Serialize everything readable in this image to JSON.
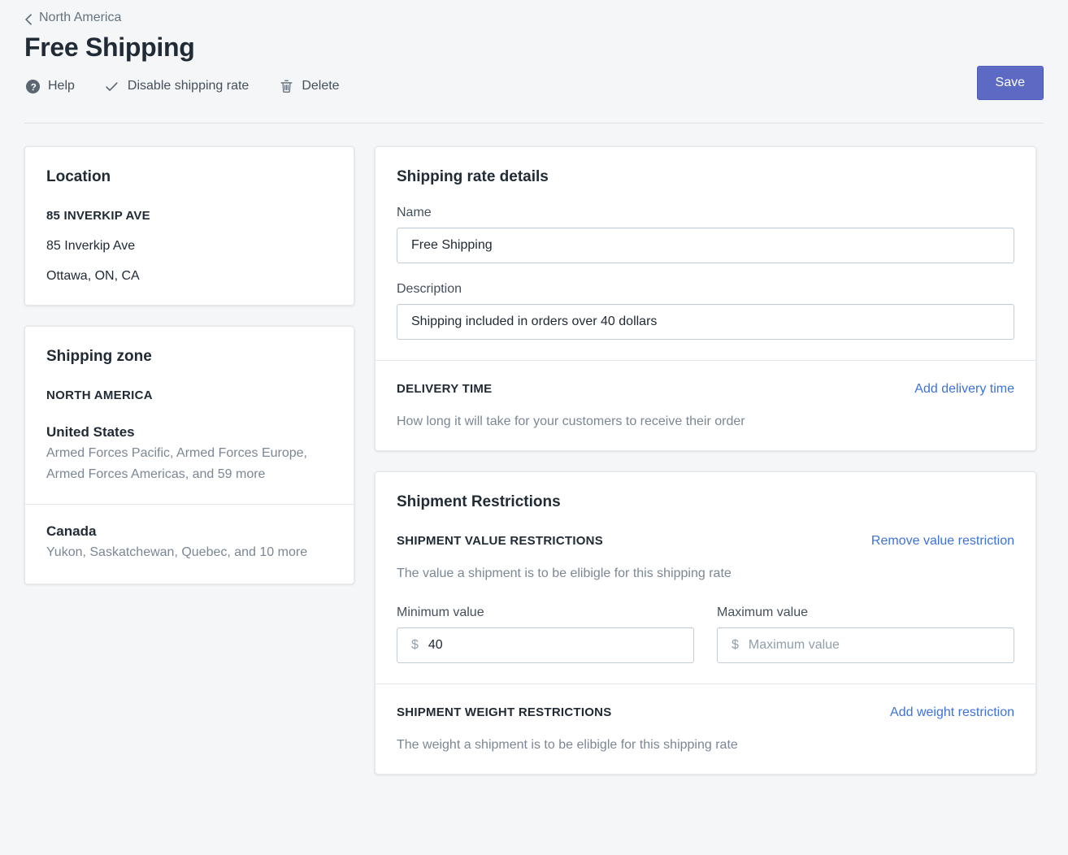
{
  "breadcrumb": {
    "label": "North America",
    "icon": "chevron-left-icon"
  },
  "header": {
    "title": "Free Shipping",
    "save_label": "Save",
    "accent_color": "#5c6ac4",
    "link_color": "#3d72d6",
    "actions": [
      {
        "label": "Help",
        "icon": "help-circle-icon"
      },
      {
        "label": "Disable shipping rate",
        "icon": "check-icon"
      },
      {
        "label": "Delete",
        "icon": "trash-icon"
      }
    ]
  },
  "location_card": {
    "title": "Location",
    "name": "85 INVERKIP AVE",
    "address_line": "85 Inverkip Ave",
    "region_line": "Ottawa, ON, CA"
  },
  "shipping_zone_card": {
    "title": "Shipping zone",
    "zone_name": "NORTH AMERICA",
    "countries": [
      {
        "name": "United States",
        "regions": "Armed Forces Pacific, Armed Forces Europe, Armed Forces Americas, and 59 more"
      },
      {
        "name": "Canada",
        "regions": "Yukon, Saskatchewan, Quebec, and 10 more"
      }
    ]
  },
  "rate_details_card": {
    "title": "Shipping rate details",
    "name_label": "Name",
    "name_value": "Free Shipping",
    "name_placeholder": "Name",
    "description_label": "Description",
    "description_value": "Shipping included in orders over 40 dollars",
    "description_placeholder": "Description",
    "delivery_time": {
      "title": "DELIVERY TIME",
      "action_label": "Add delivery time",
      "description": "How long it will take for your customers to receive their order"
    }
  },
  "restrictions_card": {
    "title": "Shipment Restrictions",
    "value_restrictions": {
      "title": "SHIPMENT VALUE RESTRICTIONS",
      "action_label": "Remove value restriction",
      "description": "The value a shipment is to be elibigle for this shipping rate",
      "minimum_label": "Minimum value",
      "minimum_value": "40",
      "minimum_placeholder": "Minimum value",
      "maximum_label": "Maximum value",
      "maximum_value": "",
      "maximum_placeholder": "Maximum value",
      "currency_symbol": "$"
    },
    "weight_restrictions": {
      "title": "SHIPMENT WEIGHT RESTRICTIONS",
      "action_label": "Add weight restriction",
      "description": "The weight a shipment is to be elibigle for this shipping rate"
    }
  }
}
